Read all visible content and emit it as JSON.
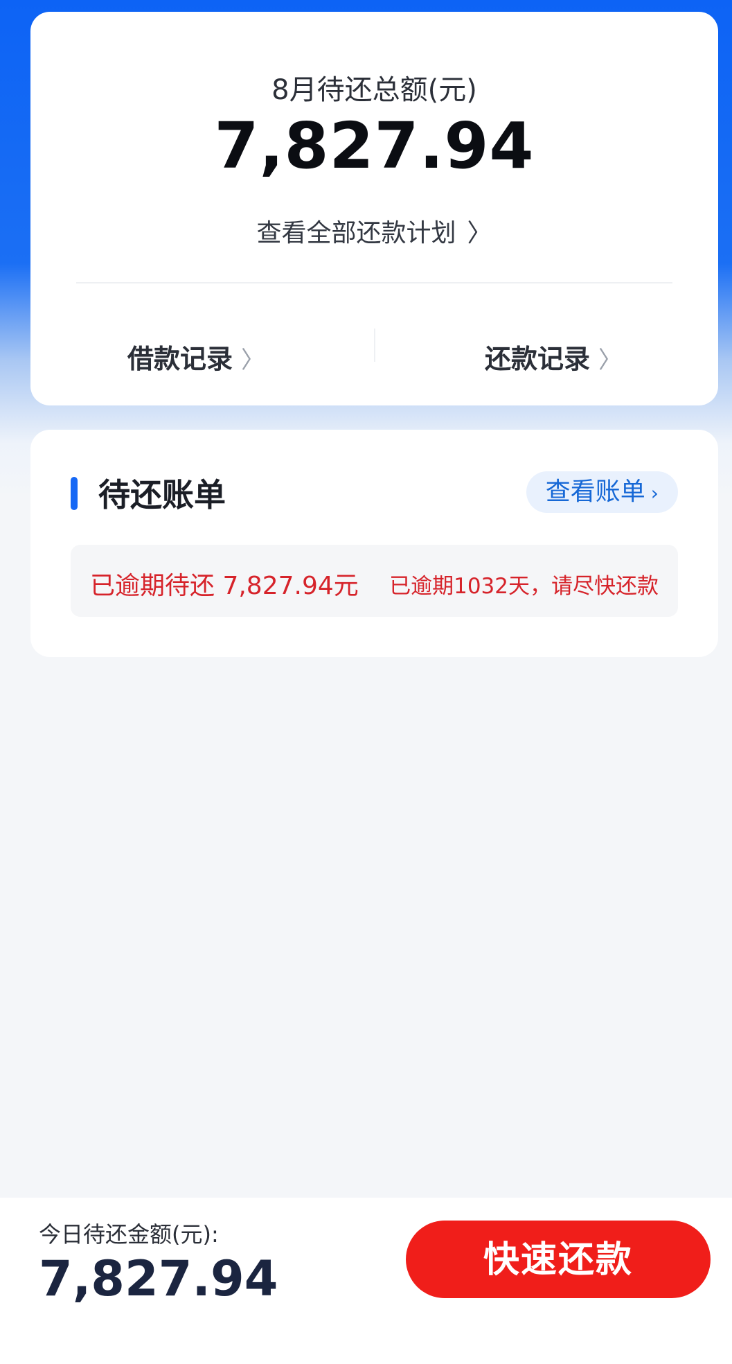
{
  "summary": {
    "title": "8月待还总额(元)",
    "amount": "7,827.94",
    "plan_link": "查看全部还款计划",
    "borrow_records": "借款记录",
    "repay_records": "还款记录"
  },
  "bill": {
    "title": "待还账单",
    "view_bill": "查看账单",
    "overdue_amount": "已逾期待还 7,827.94元",
    "overdue_notice": "已逾期1032天，请尽快还款"
  },
  "footer": {
    "today_label": "今日待还金额(元):",
    "today_amount": "7,827.94",
    "pay_button": "快速还款"
  },
  "icons": {
    "chevron": "chevron-right-icon"
  },
  "colors": {
    "brand_blue": "#1668f5",
    "overdue_red": "#d6232a",
    "pay_button_red": "#f01e1a"
  }
}
